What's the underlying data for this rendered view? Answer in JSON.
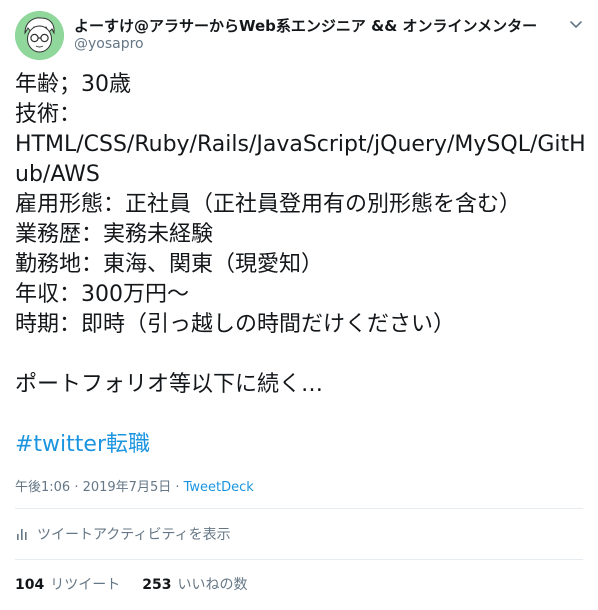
{
  "user": {
    "display_name": "よーすけ@アラサーからWeb系エンジニア && オンラインメンター",
    "handle": "@yosapro"
  },
  "tweet": {
    "lines": [
      "年齢；30歳",
      "技術：",
      "HTML/CSS/Ruby/Rails/JavaScript/jQuery/MySQL/GitH",
      "ub/AWS",
      "雇用形態：正社員（正社員登用有の別形態を含む）",
      "業務歴：実務未経験",
      "勤務地：東海、関東（現愛知）",
      "年収：300万円〜",
      "時期：即時（引っ越しの時間だけください）",
      "",
      "ポートフォリオ等以下に続く…"
    ],
    "hashtag": "#twitter転職"
  },
  "meta": {
    "datetime": "午後1:06 · 2019年7月5日 · ",
    "source": "TweetDeck"
  },
  "activity_label": "ツイートアクティビティを表示",
  "stats": {
    "retweets_count": "104",
    "retweets_label": "リツイート",
    "likes_count": "253",
    "likes_label": "いいねの数"
  },
  "colors": {
    "link": "#1b95e0",
    "secondary_text": "#657786",
    "primary_text": "#14171a",
    "divider": "#e6ecf0"
  },
  "icons": {
    "caret": "chevron-down-icon",
    "activity": "bar-chart-icon"
  }
}
